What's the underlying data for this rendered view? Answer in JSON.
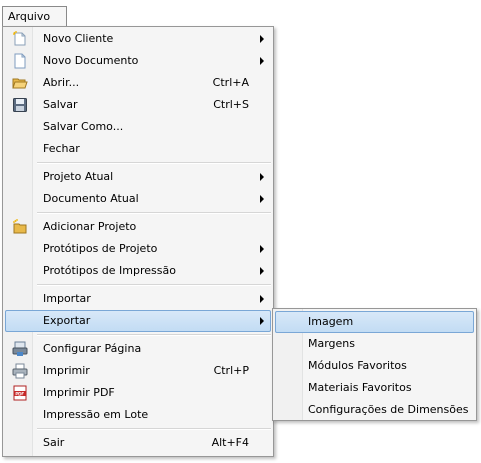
{
  "menubar": {
    "title": "Arquivo"
  },
  "menu": {
    "items": [
      {
        "label": "Novo Cliente",
        "shortcut": "",
        "icon": "new-client-icon"
      },
      {
        "label": "Novo Documento",
        "shortcut": "",
        "icon": "new-document-icon"
      },
      {
        "label": "Abrir...",
        "shortcut": "Ctrl+A",
        "icon": "open-folder-icon"
      },
      {
        "label": "Salvar",
        "shortcut": "Ctrl+S",
        "icon": "save-icon"
      },
      {
        "label": "Salvar Como...",
        "shortcut": ""
      },
      {
        "label": "Fechar",
        "shortcut": ""
      },
      {
        "label": "Projeto Atual",
        "shortcut": ""
      },
      {
        "label": "Documento Atual",
        "shortcut": ""
      },
      {
        "label": "Adicionar Projeto",
        "shortcut": "",
        "icon": "add-project-icon"
      },
      {
        "label": "Protótipos de Projeto",
        "shortcut": ""
      },
      {
        "label": "Protótipos de Impressão",
        "shortcut": ""
      },
      {
        "label": "Importar",
        "shortcut": ""
      },
      {
        "label": "Exportar",
        "shortcut": ""
      },
      {
        "label": "Configurar Página",
        "shortcut": "",
        "icon": "page-setup-icon"
      },
      {
        "label": "Imprimir",
        "shortcut": "Ctrl+P",
        "icon": "printer-icon"
      },
      {
        "label": "Imprimir PDF",
        "shortcut": "",
        "icon": "pdf-icon"
      },
      {
        "label": "Impressão em Lote",
        "shortcut": ""
      },
      {
        "label": "Sair",
        "shortcut": "Alt+F4"
      }
    ]
  },
  "submenu": {
    "items": [
      {
        "label": "Imagem"
      },
      {
        "label": "Margens"
      },
      {
        "label": "Módulos Favoritos"
      },
      {
        "label": "Materiais Favoritos"
      },
      {
        "label": "Configurações de Dimensões"
      }
    ]
  },
  "colors": {
    "highlight": "#c8def6",
    "highlight_border": "#7aa7d6",
    "menu_background": "#f5f5f5"
  }
}
